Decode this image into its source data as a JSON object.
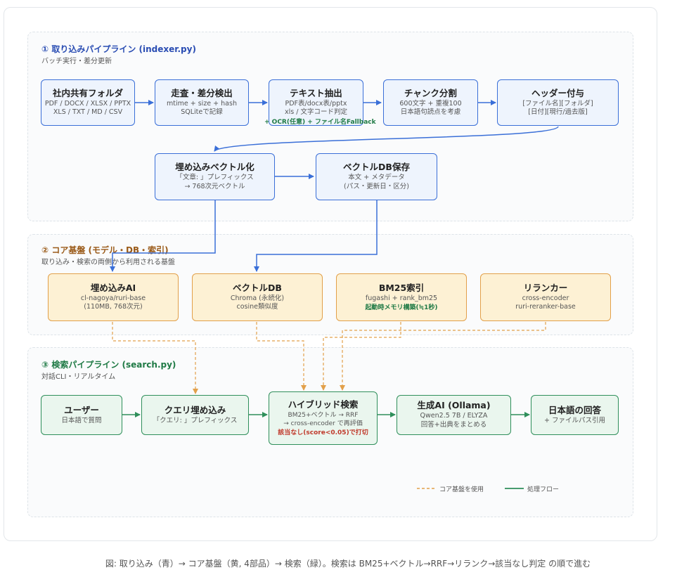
{
  "sections": {
    "ingest": {
      "title": "① 取り込みパイプライン (indexer.py)",
      "subtitle": "バッチ実行・差分更新"
    },
    "core": {
      "title": "② コア基盤 (モデル・DB・索引)",
      "subtitle": "取り込み・検索の両側から利用される基盤"
    },
    "search": {
      "title": "③ 検索パイプライン (search.py)",
      "subtitle": "対話CLI・リアルタイム"
    }
  },
  "nodes": {
    "folder": {
      "title": "社内共有フォルダ",
      "line1": "PDF / DOCX / XLSX / PPTX",
      "line2": "XLS / TXT / MD / CSV"
    },
    "scan": {
      "title": "走査・差分検出",
      "line1": "mtime + size + hash",
      "line2": "SQLiteで記録"
    },
    "extract": {
      "title": "テキスト抽出",
      "line1": "PDF表/docx表/pptx",
      "line2": "xls / 文字コード判定",
      "note": "+ OCR(任意) + ファイル名Fallback"
    },
    "chunk": {
      "title": "チャンク分割",
      "line1": "600文字 + 重複100",
      "line2": "日本語句読点を考慮"
    },
    "header": {
      "title": "ヘッダー付与",
      "line1": "[ファイル名][フォルダ]",
      "line2": "[日付][現行/過去版]"
    },
    "embed": {
      "title": "埋め込みベクトル化",
      "line1": "「文章: 」プレフィックス",
      "line2": "→ 768次元ベクトル"
    },
    "store": {
      "title": "ベクトルDB保存",
      "line1": "本文 + メタデータ",
      "line2": "(パス・更新日・区分)"
    },
    "embed_ai": {
      "title": "埋め込みAI",
      "line1": "cl-nagoya/ruri-base",
      "line2": "(110MB, 768次元)"
    },
    "vectordb": {
      "title": "ベクトルDB",
      "line1": "Chroma (永続化)",
      "line2": "cosine類似度"
    },
    "bm25": {
      "title": "BM25索引",
      "line1": "fugashi + rank_bm25",
      "note": "起動時メモリ構築(≒1秒)"
    },
    "reranker": {
      "title": "リランカー",
      "line1": "cross-encoder",
      "line2": "ruri-reranker-base"
    },
    "user": {
      "title": "ユーザー",
      "line1": "日本語で質問"
    },
    "query": {
      "title": "クエリ埋め込み",
      "line1": "「クエリ: 」プレフィックス"
    },
    "hybrid": {
      "title": "ハイブリッド検索",
      "line1": "BM25+ベクトル → RRF",
      "line2": "→ cross-encoder で再評価",
      "note": "該当なし(score<0.05)で打切"
    },
    "genai": {
      "title": "生成AI (Ollama)",
      "line1": "Qwen2.5 7B / ELYZA",
      "line2": "回答+出典をまとめる"
    },
    "answer": {
      "title": "日本語の回答",
      "line1": "+ ファイルパス引用"
    }
  },
  "legend": {
    "core_use": "コア基盤を使用",
    "flow": "処理フロー"
  },
  "caption": "図: 取り込み（青）→ コア基盤（黄, 4部品）→ 検索（緑）。検索は BM25+ベクトル→RRF→リランク→該当なし判定 の順で進む",
  "colors": {
    "blue": "#3a6fd8",
    "yellow": "#e2a04a",
    "green": "#2f8f5b",
    "note_green": "#1f7a45",
    "note_red": "#c0392b"
  }
}
